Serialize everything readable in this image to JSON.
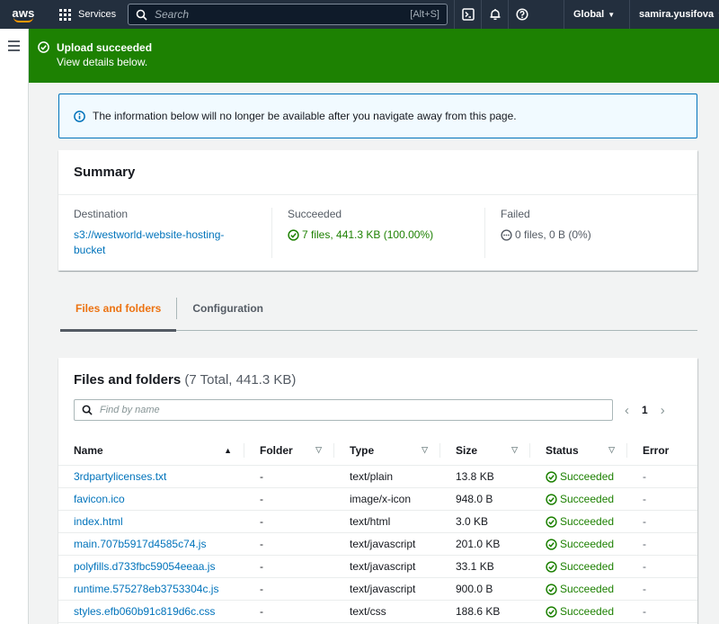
{
  "nav": {
    "logo": "aws",
    "services": "Services",
    "search_placeholder": "Search",
    "search_shortcut": "[Alt+S]",
    "region": "Global",
    "user": "samira.yusifova"
  },
  "flash": {
    "title": "Upload succeeded",
    "subtitle": "View details below."
  },
  "info": {
    "text": "The information below will no longer be available after you navigate away from this page."
  },
  "summary": {
    "title": "Summary",
    "destination_label": "Destination",
    "destination_value_line1": "s3://westworld-website-hosting-",
    "destination_value_line2": "bucket",
    "succeeded_label": "Succeeded",
    "succeeded_value": "7 files, 441.3 KB (100.00%)",
    "failed_label": "Failed",
    "failed_value": "0 files, 0 B (0%)"
  },
  "tabs": [
    {
      "label": "Files and folders"
    },
    {
      "label": "Configuration"
    }
  ],
  "files": {
    "title": "Files and folders",
    "count": "(7 Total, 441.3 KB)",
    "search_placeholder": "Find by name",
    "page": "1",
    "columns": [
      "Name",
      "Folder",
      "Type",
      "Size",
      "Status",
      "Error"
    ],
    "rows": [
      {
        "name": "3rdpartylicenses.txt",
        "folder": "-",
        "type": "text/plain",
        "size": "13.8 KB",
        "status": "Succeeded",
        "error": "-"
      },
      {
        "name": "favicon.ico",
        "folder": "-",
        "type": "image/x-icon",
        "size": "948.0 B",
        "status": "Succeeded",
        "error": "-"
      },
      {
        "name": "index.html",
        "folder": "-",
        "type": "text/html",
        "size": "3.0 KB",
        "status": "Succeeded",
        "error": "-"
      },
      {
        "name": "main.707b5917d4585c74.js",
        "folder": "-",
        "type": "text/javascript",
        "size": "201.0 KB",
        "status": "Succeeded",
        "error": "-"
      },
      {
        "name": "polyfills.d733fbc59054eeaa.js",
        "folder": "-",
        "type": "text/javascript",
        "size": "33.1 KB",
        "status": "Succeeded",
        "error": "-"
      },
      {
        "name": "runtime.575278eb3753304c.js",
        "folder": "-",
        "type": "text/javascript",
        "size": "900.0 B",
        "status": "Succeeded",
        "error": "-"
      },
      {
        "name": "styles.efb060b91c819d6c.css",
        "folder": "-",
        "type": "text/css",
        "size": "188.6 KB",
        "status": "Succeeded",
        "error": "-"
      }
    ]
  }
}
